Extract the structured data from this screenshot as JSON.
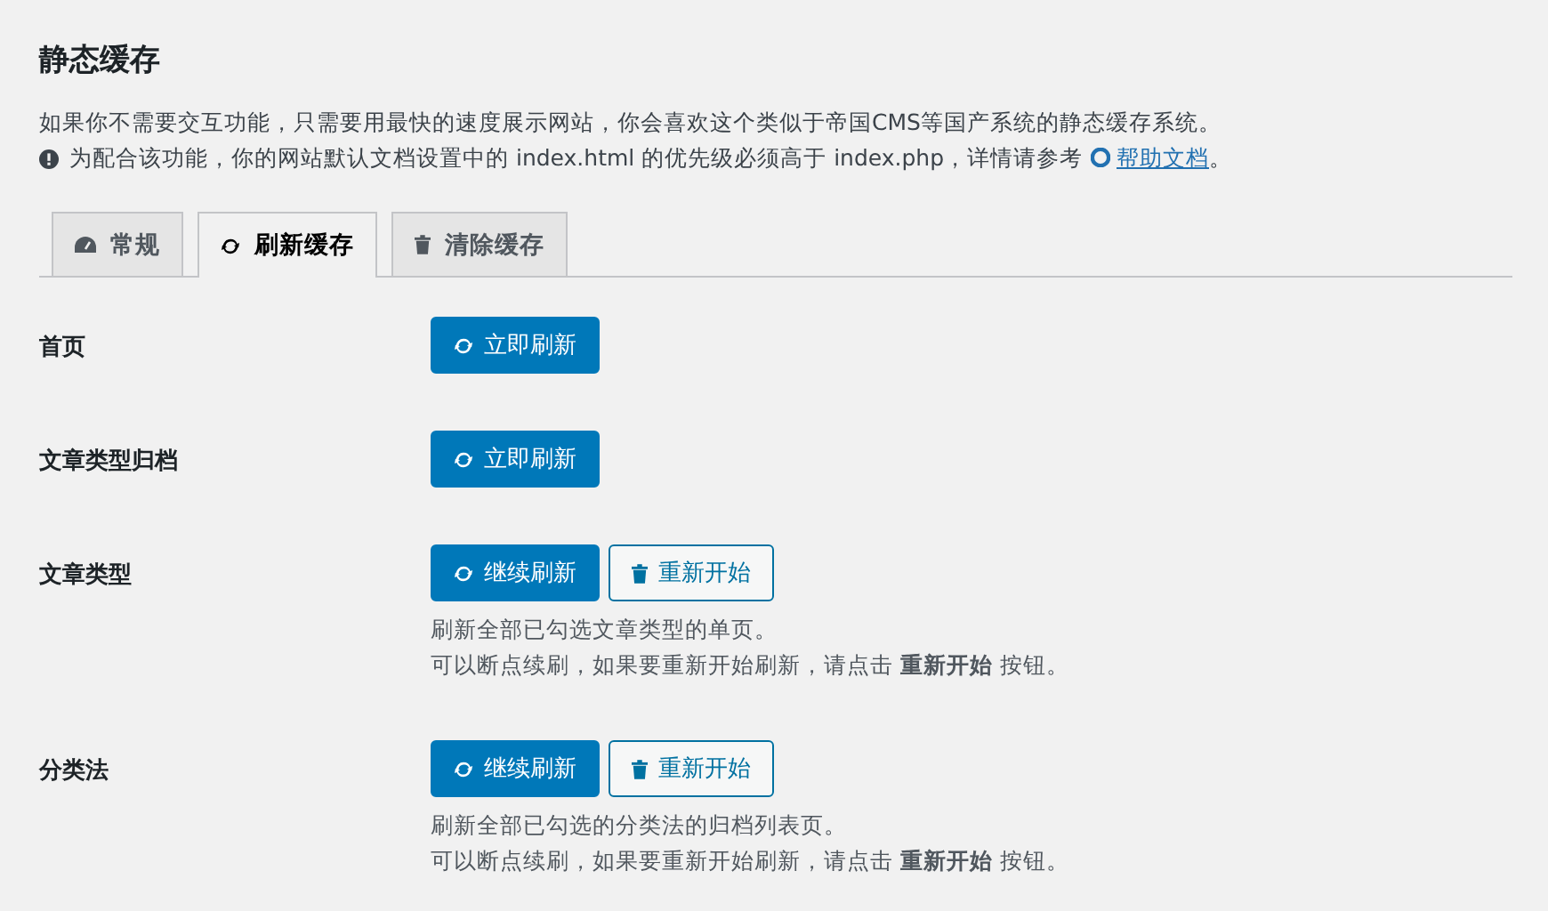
{
  "title": "静态缓存",
  "intro": "如果你不需要交互功能，只需要用最快的速度展示网站，你会喜欢这个类似于帝国CMS等国产系统的静态缓存系统。",
  "notice": {
    "text": "为配合该功能，你的网站默认文档设置中的 index.html 的优先级必须高于 index.php，详情请参考",
    "link": "帮助文档",
    "end": "。"
  },
  "tabs": [
    {
      "label": "常规",
      "selected": false
    },
    {
      "label": "刷新缓存",
      "selected": true
    },
    {
      "label": "清除缓存",
      "selected": false
    }
  ],
  "rows": [
    {
      "label": "首页",
      "buttons": [
        {
          "kind": "primary",
          "label": "立即刷新"
        }
      ]
    },
    {
      "label": "文章类型归档",
      "buttons": [
        {
          "kind": "primary",
          "label": "立即刷新"
        }
      ]
    },
    {
      "label": "文章类型",
      "buttons": [
        {
          "kind": "primary",
          "label": "继续刷新"
        },
        {
          "kind": "secondary",
          "label": "重新开始"
        }
      ],
      "description": [
        "刷新全部已勾选文章类型的单页。",
        "可以断点续刷，如果要重新开始刷新，请点击 **重新开始** 按钮。"
      ]
    },
    {
      "label": "分类法",
      "buttons": [
        {
          "kind": "primary",
          "label": "继续刷新"
        },
        {
          "kind": "secondary",
          "label": "重新开始"
        }
      ],
      "description": [
        "刷新全部已勾选的分类法的归档列表页。",
        "可以断点续刷，如果要重新开始刷新，请点击 **重新开始** 按钮。"
      ]
    }
  ]
}
